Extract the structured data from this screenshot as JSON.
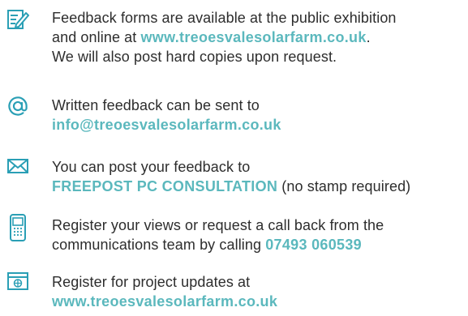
{
  "colors": {
    "accent": "#5bb8bd",
    "text": "#2d2d2d",
    "icon": "#2a9fb5"
  },
  "items": [
    {
      "icon": "feedback-form-icon",
      "line1": "Feedback forms are available at the public exhibition",
      "line2_prefix": "and online at ",
      "line2_link": "www.treoesvalesolarfarm.co.uk",
      "line2_suffix": ".",
      "line3": "We will also post hard copies upon request."
    },
    {
      "icon": "at-sign-icon",
      "line1": "Written feedback can be sent to",
      "email": "info@treoesvalesolarfarm.co.uk"
    },
    {
      "icon": "envelope-icon",
      "line1": "You can post your feedback to",
      "address": "FREEPOST PC CONSULTATION",
      "address_suffix": " (no stamp required)"
    },
    {
      "icon": "mobile-phone-icon",
      "line1": "Register your views or request a call back from the",
      "line2_prefix": "communications team by calling ",
      "phone": "07493 060539"
    },
    {
      "icon": "browser-window-icon",
      "line1": "Register for project updates at",
      "website": "www.treoesvalesolarfarm.co.uk"
    }
  ]
}
